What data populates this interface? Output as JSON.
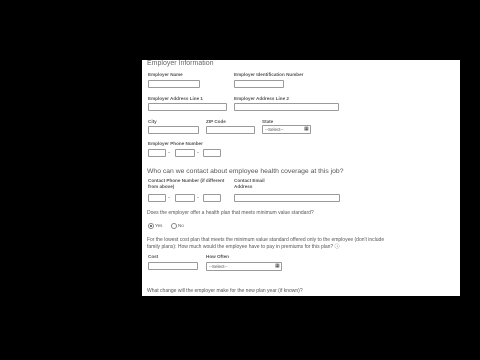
{
  "section": {
    "title": "Employer Information"
  },
  "fields": {
    "employer_name": {
      "label": "Employer Name",
      "value": ""
    },
    "employer_id": {
      "label": "Employer Identification Number",
      "value": ""
    },
    "address1": {
      "label": "Employer Address Line 1",
      "value": ""
    },
    "address2": {
      "label": "Employer Address Line 2",
      "value": ""
    },
    "city": {
      "label": "City",
      "value": ""
    },
    "zip": {
      "label": "ZIP Code",
      "value": ""
    },
    "state": {
      "label": "State",
      "selected": "--Select--"
    },
    "phone": {
      "label": "Employer Phone Number"
    }
  },
  "contact": {
    "question": "Who can we contact about employee health coverage at this job?",
    "phone_label_line1": "Contact Phone Number (if different",
    "phone_label_line2": "from above)",
    "email_label_line1": "Contact Email",
    "email_label_line2": "Address"
  },
  "health_plan": {
    "question": "Does the employer offer a health plan that meets minimum value standard?",
    "options": [
      {
        "label": "Yes",
        "selected": true
      },
      {
        "label": "No",
        "selected": false
      }
    ]
  },
  "lowest_plan": {
    "question_line1": "For the lowest cost plan that meets the minimum value standard offered only to the employee (don't include",
    "question_line2": "family plans): How much would the employee have to pay in premiums for this plan?",
    "help_icon": "help-circle-icon",
    "cost_label": "Cost",
    "how_often_label": "How Often",
    "how_often_selected": "--Select--"
  },
  "change": {
    "question": "What change will the employer make for the new plan year (if known)?"
  }
}
